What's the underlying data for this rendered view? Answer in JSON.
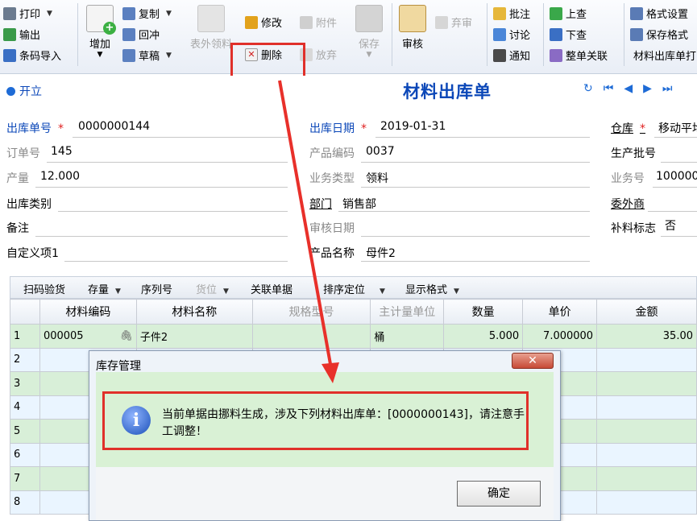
{
  "ribbon": {
    "print": "打印",
    "output": "输出",
    "barcode_import": "条码导入",
    "add": "增加",
    "copy": "复制",
    "write_back": "回冲",
    "draft": "草稿",
    "outer_pick": "表外领料",
    "modify": "修改",
    "attach": "附件",
    "save": "保存",
    "delete": "删除",
    "abandon_release": "放弃",
    "audit": "审核",
    "discard_audit": "弃审",
    "annotate": "批注",
    "discuss": "讨论",
    "notify": "通知",
    "prev_record": "上查",
    "next_record": "下查",
    "whole_link": "整单关联",
    "format_settings": "格式设置",
    "save_format": "保存格式",
    "format_name": "材料出库单打"
  },
  "nav": {
    "open_label": "开立",
    "form_title": "材料出库单"
  },
  "header_fields": {
    "out_no_label": "出库单号",
    "out_no": "0000000144",
    "order_no_label": "订单号",
    "order_no": "145",
    "output_label": "产量",
    "output": "12.000",
    "out_type_label": "出库类别",
    "out_type": "",
    "remark_label": "备注",
    "remark": "",
    "custom1_label": "自定义项1",
    "custom1": "",
    "out_date_label": "出库日期",
    "out_date": "2019-01-31",
    "product_code_label": "产品编码",
    "product_code": "0037",
    "biz_type_label": "业务类型",
    "biz_type": "领料",
    "dept_label": "部门",
    "dept": "销售部",
    "audit_date_label": "审核日期",
    "audit_date": "",
    "product_name_label": "产品名称",
    "product_name": "母件2",
    "warehouse_label": "仓库",
    "warehouse": "移动平均",
    "batch_label": "生产批号",
    "batch": "",
    "biz_no_label": "业务号",
    "biz_no": "100000",
    "outsourcer_label": "委外商",
    "outsourcer": "",
    "supp_flag_label": "补料标志",
    "supp_flag": "否"
  },
  "grid_toolbar": {
    "scan": "扫码验货",
    "stock": "存量",
    "serial": "序列号",
    "location": "货位",
    "link_doc": "关联单据",
    "sort_locate": "排序定位",
    "display_format": "显示格式"
  },
  "grid": {
    "columns": [
      "",
      "材料编码",
      "材料名称",
      "规格型号",
      "主计量单位",
      "数量",
      "单价",
      "金额"
    ],
    "rows": [
      [
        "1",
        "000005",
        "子件2",
        "",
        "桶",
        "5.000",
        "7.000000",
        "35.00"
      ],
      [
        "2",
        "",
        "",
        "",
        "",
        "",
        "",
        ""
      ],
      [
        "3",
        "",
        "",
        "",
        "",
        "",
        "",
        ""
      ],
      [
        "4",
        "",
        "",
        "",
        "",
        "",
        "",
        ""
      ],
      [
        "5",
        "",
        "",
        "",
        "",
        "",
        "",
        ""
      ],
      [
        "6",
        "",
        "",
        "",
        "",
        "",
        "",
        ""
      ],
      [
        "7",
        "",
        "",
        "",
        "",
        "",
        "",
        ""
      ],
      [
        "8",
        "",
        "",
        "",
        "",
        "",
        "",
        ""
      ]
    ]
  },
  "dialog": {
    "title": "库存管理",
    "close": "✕",
    "message": "当前单据由挪料生成，涉及下列材料出库单：[0000000143]，请注意手工调整！",
    "ok": "确定"
  },
  "colors": {
    "accent": "#0b47b8",
    "highlight": "#e0302a",
    "row_green": "#d8efd8"
  }
}
